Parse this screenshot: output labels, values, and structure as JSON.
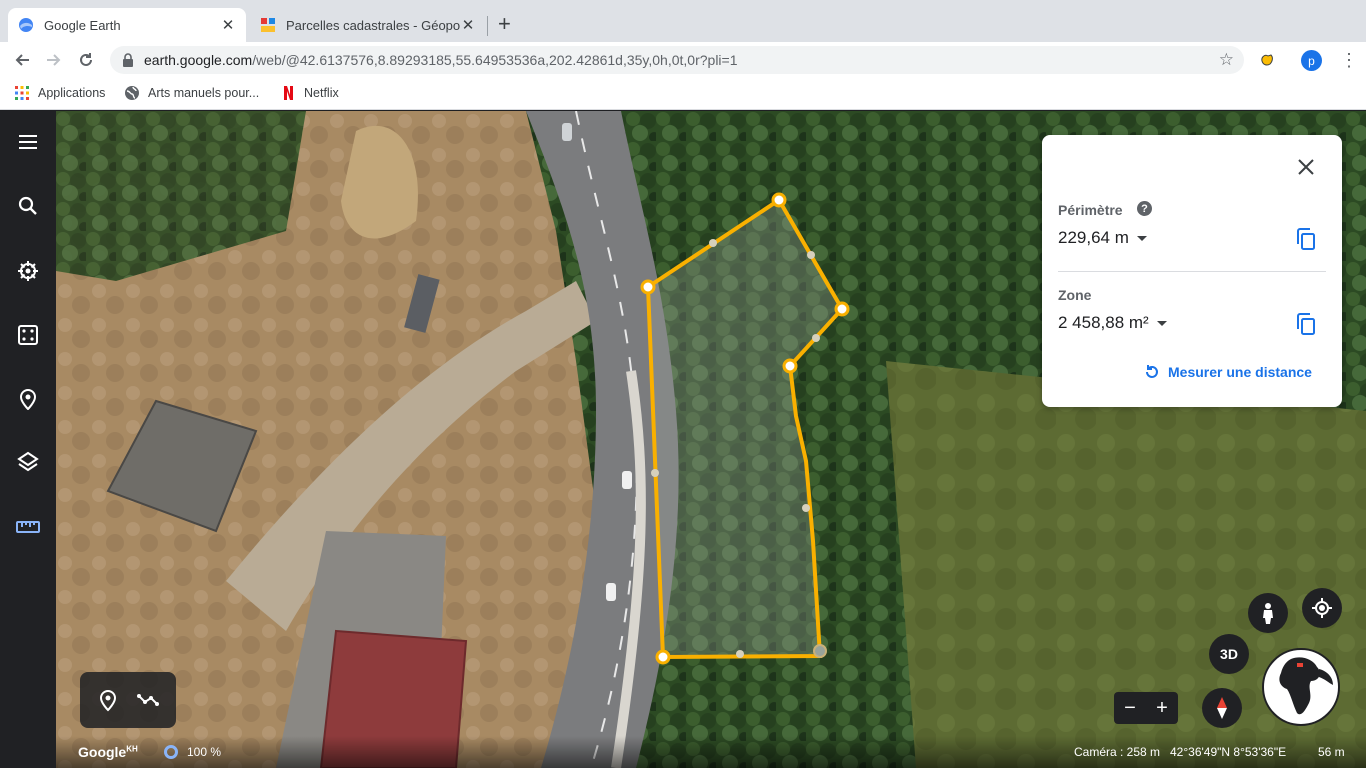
{
  "browser": {
    "tabs": [
      {
        "title": "Google Earth",
        "active": true
      },
      {
        "title": "Parcelles cadastrales - Géopor",
        "active": false
      }
    ],
    "url_host": "earth.google.com",
    "url_path": "/web/@42.6137576,8.89293185,55.64953536a,202.42861d,35y,0h,0t,0r?pli=1",
    "profile_initial": "p",
    "bookmarks": [
      "Applications",
      "Arts manuels pour...",
      "Netflix"
    ]
  },
  "measure": {
    "perimeter_label": "Périmètre",
    "perimeter_value": "229,64 m",
    "area_label": "Zone",
    "area_value": "2 458,88 m²",
    "link_label": "Mesurer une distance",
    "help_glyph": "?"
  },
  "controls": {
    "btn_3d": "3D",
    "zoom_out": "−",
    "zoom_in": "+"
  },
  "status": {
    "logo": "Google",
    "logo_sup": "KH",
    "progress": "100 %",
    "camera": "Caméra : 258 m",
    "coords": "42°36'49\"N 8°53'36\"E",
    "scale": "56 m"
  },
  "colors": {
    "measure_line": "#f9b000",
    "accent": "#1a73e8",
    "sidebar": "#202124",
    "active_tool": "#8ab4f8"
  },
  "icons": [
    "menu-icon",
    "search-icon",
    "voyager-icon",
    "feeling-lucky-icon",
    "projects-icon",
    "map-style-icon",
    "measure-icon",
    "placemark-icon",
    "path-icon",
    "pegman-icon",
    "my-location-icon",
    "compass-icon",
    "close-icon",
    "copy-icon",
    "refresh-icon"
  ]
}
